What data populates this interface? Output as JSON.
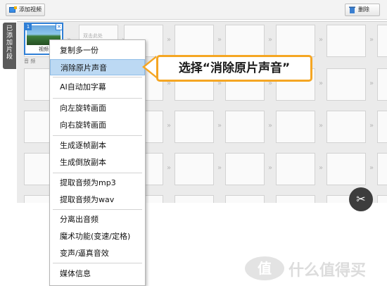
{
  "toolbar": {
    "add_label": "添加视频",
    "delete_label": "删除"
  },
  "sidebar": {
    "tab_chars": [
      "已",
      "添",
      "加",
      "片",
      "段"
    ]
  },
  "grid": {
    "audio_label": "音 频",
    "thumb_number": "1",
    "thumb_label": "视频",
    "ghost_label": "双击此处"
  },
  "context_menu": {
    "items": [
      {
        "label": "复制多一份"
      },
      {
        "label": "消除原片声音",
        "active": true
      },
      {
        "label": "AI自动加字幕"
      },
      {
        "label": "向左旋转画面"
      },
      {
        "label": "向右旋转画面"
      },
      {
        "label": "生成逐帧副本"
      },
      {
        "label": "生成倒放副本"
      },
      {
        "label": "提取音频为mp3"
      },
      {
        "label": "提取音频为wav"
      },
      {
        "label": "分离出音频"
      },
      {
        "label": "魔术功能(变速/定格)"
      },
      {
        "label": "变声/逼真音效"
      },
      {
        "label": "媒体信息"
      }
    ]
  },
  "callout": {
    "text": "选择“消除原片声音”"
  },
  "watermark": {
    "logo": "值",
    "text": "什么值得买"
  },
  "colors": {
    "accent": "#f5a623",
    "highlight": "#bcd9f3",
    "selection": "#2f7fd6"
  }
}
